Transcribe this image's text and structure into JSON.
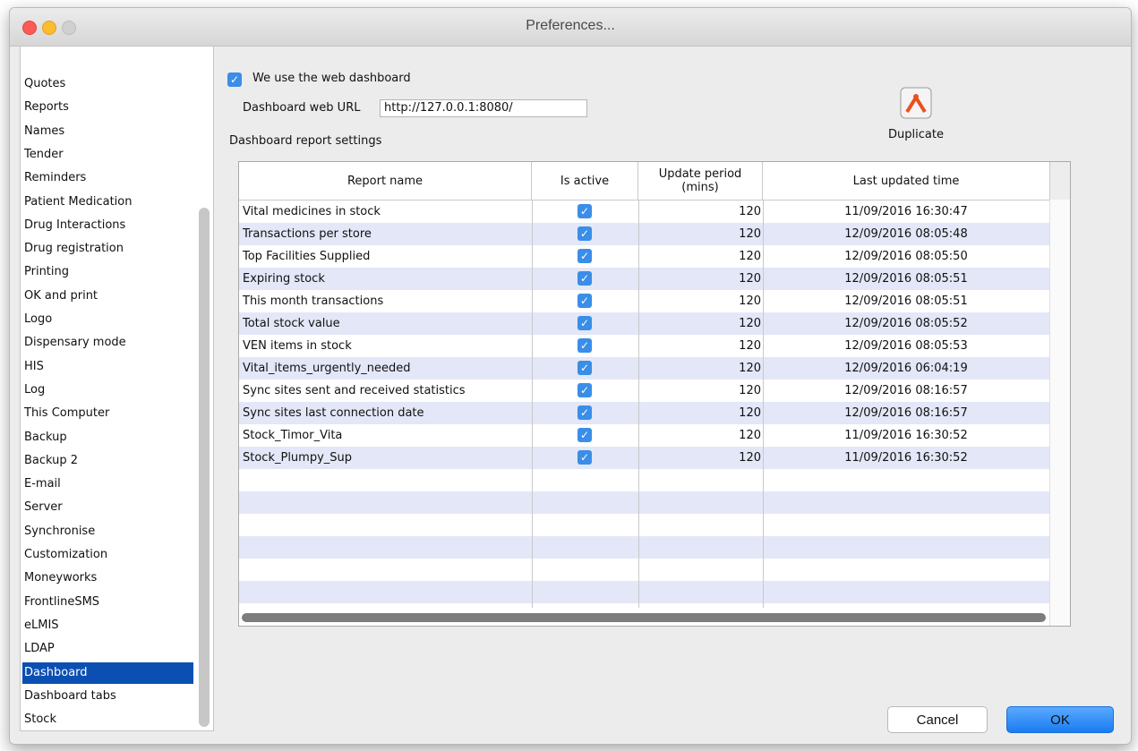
{
  "window": {
    "title": "Preferences..."
  },
  "sidebar": {
    "items": [
      "Quotes",
      "Reports",
      "Names",
      "Tender",
      "Reminders",
      "Patient Medication",
      "Drug Interactions",
      "Drug registration",
      "Printing",
      "OK and print",
      "Logo",
      "Dispensary mode",
      "HIS",
      "Log",
      "This Computer",
      "Backup",
      "Backup 2",
      "E-mail",
      "Server",
      "Synchronise",
      "Customization",
      "Moneyworks",
      "FrontlineSMS",
      "eLMIS",
      "LDAP",
      "Dashboard",
      "Dashboard tabs",
      "Stock"
    ],
    "selected": "Dashboard"
  },
  "settings": {
    "web_dashboard_label": "We use the web dashboard",
    "web_dashboard_checked": true,
    "url_label": "Dashboard web URL",
    "url_value": "http://127.0.0.1:8080/",
    "report_settings_label": "Dashboard report settings",
    "duplicate_label": "Duplicate"
  },
  "table": {
    "columns": [
      "Report name",
      "Is active",
      "Update period\n(mins)",
      "Last updated time"
    ],
    "rows": [
      {
        "name": "Vital medicines in stock",
        "active": true,
        "period": "120",
        "updated": "11/09/2016 16:30:47"
      },
      {
        "name": "Transactions per store",
        "active": true,
        "period": "120",
        "updated": "12/09/2016 08:05:48"
      },
      {
        "name": "Top Facilities Supplied",
        "active": true,
        "period": "120",
        "updated": "12/09/2016 08:05:50"
      },
      {
        "name": "Expiring stock",
        "active": true,
        "period": "120",
        "updated": "12/09/2016 08:05:51"
      },
      {
        "name": "This month transactions",
        "active": true,
        "period": "120",
        "updated": "12/09/2016 08:05:51"
      },
      {
        "name": "Total stock value",
        "active": true,
        "period": "120",
        "updated": "12/09/2016 08:05:52"
      },
      {
        "name": "VEN items in stock",
        "active": true,
        "period": "120",
        "updated": "12/09/2016 08:05:53"
      },
      {
        "name": "Vital_items_urgently_needed",
        "active": true,
        "period": "120",
        "updated": "12/09/2016 06:04:19"
      },
      {
        "name": "Sync sites sent and received statistics",
        "active": true,
        "period": "120",
        "updated": "12/09/2016 08:16:57"
      },
      {
        "name": "Sync sites last connection date",
        "active": true,
        "period": "120",
        "updated": "12/09/2016 08:16:57"
      },
      {
        "name": "Stock_Timor_Vita",
        "active": true,
        "period": "120",
        "updated": "11/09/2016 16:30:52"
      },
      {
        "name": "Stock_Plumpy_Sup",
        "active": true,
        "period": "120",
        "updated": "11/09/2016 16:30:52"
      }
    ],
    "empty_rows": 6
  },
  "buttons": {
    "cancel": "Cancel",
    "ok": "OK"
  },
  "colors": {
    "selection": "#0b4fb3",
    "checkbox": "#3a8ee8",
    "row_alt": "#e3e7f7",
    "ok_button": "#1a7cf0"
  }
}
